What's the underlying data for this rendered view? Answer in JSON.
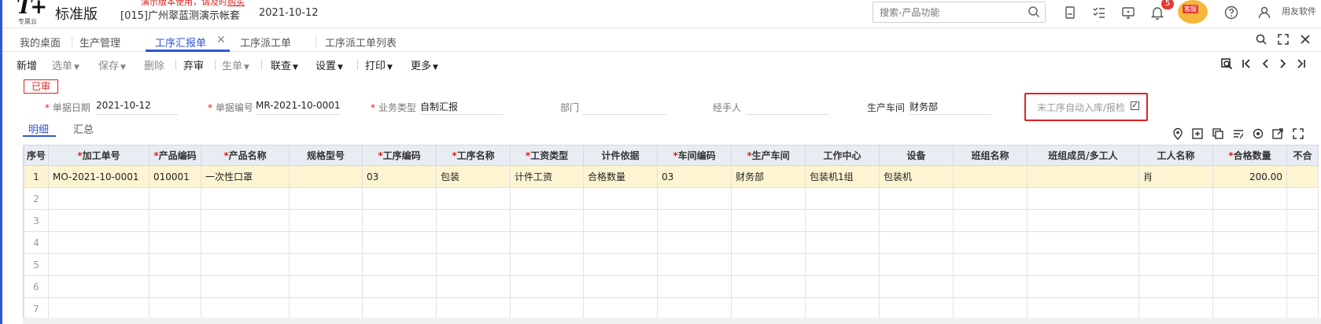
{
  "app": {
    "logo": "T+",
    "logo_sub": "专属云",
    "edition": "标准版",
    "demo_warning_prefix": "演示版本使用，请及时",
    "demo_warning_link": "购买",
    "account": "[015]广州翠蓝测演示帐套",
    "date": "2021-10-12",
    "search_placeholder": "搜索-产品功能",
    "notification_count": "5",
    "avatar_tag": "客服",
    "user": "用友软件"
  },
  "tabs": [
    {
      "label": "我的桌面"
    },
    {
      "label": "生产管理"
    },
    {
      "label": "工序汇报单"
    },
    {
      "label": "工序派工单"
    },
    {
      "label": "工序派工单列表"
    }
  ],
  "toolbar": {
    "items": [
      "新增",
      "选单",
      "保存",
      "删除",
      "弃审",
      "生单",
      "联查",
      "设置",
      "打印",
      "更多"
    ]
  },
  "status_tag": "已审",
  "form": {
    "date_label": "单据日期",
    "date_value": "2021-10-12",
    "code_label": "单据编号",
    "code_value": "MR-2021-10-0001",
    "biz_label": "业务类型",
    "biz_value": "自制汇报",
    "dept_label": "部门",
    "dept_value": "",
    "handler_label": "经手人",
    "handler_value": "",
    "workshop_label": "生产车间",
    "workshop_value": "财务部",
    "auto_label": "末工序自动入库/报检",
    "auto_checked": "✓"
  },
  "subtabs": [
    "明细",
    "汇总"
  ],
  "table": {
    "headers": [
      {
        "label": "序号",
        "req": ""
      },
      {
        "label": "加工单号",
        "req": "*"
      },
      {
        "label": "产品编码",
        "req": "*"
      },
      {
        "label": "产品名称",
        "req": "*"
      },
      {
        "label": "规格型号",
        "req": ""
      },
      {
        "label": "工序编码",
        "req": "*"
      },
      {
        "label": "工序名称",
        "req": "*"
      },
      {
        "label": "工资类型",
        "req": "*"
      },
      {
        "label": "计件依据",
        "req": ""
      },
      {
        "label": "车间编码",
        "req": "*"
      },
      {
        "label": "生产车间",
        "req": "*"
      },
      {
        "label": "工作中心",
        "req": ""
      },
      {
        "label": "设备",
        "req": ""
      },
      {
        "label": "班组名称",
        "req": ""
      },
      {
        "label": "班组成员/多工人",
        "req": ""
      },
      {
        "label": "工人名称",
        "req": ""
      },
      {
        "label": "合格数量",
        "req": "*"
      },
      {
        "label": "不合",
        "req": ""
      }
    ],
    "rows": [
      [
        "1",
        "MO-2021-10-0001",
        "010001",
        "一次性口罩",
        "",
        "03",
        "包装",
        "计件工资",
        "合格数量",
        "03",
        "财务部",
        "包装机1组",
        "包装机",
        "",
        "",
        "肖",
        "200.00",
        ""
      ],
      [
        "2",
        "",
        "",
        "",
        "",
        "",
        "",
        "",
        "",
        "",
        "",
        "",
        "",
        "",
        "",
        "",
        "",
        ""
      ],
      [
        "3",
        "",
        "",
        "",
        "",
        "",
        "",
        "",
        "",
        "",
        "",
        "",
        "",
        "",
        "",
        "",
        "",
        ""
      ],
      [
        "4",
        "",
        "",
        "",
        "",
        "",
        "",
        "",
        "",
        "",
        "",
        "",
        "",
        "",
        "",
        "",
        "",
        ""
      ],
      [
        "5",
        "",
        "",
        "",
        "",
        "",
        "",
        "",
        "",
        "",
        "",
        "",
        "",
        "",
        "",
        "",
        "",
        ""
      ],
      [
        "6",
        "",
        "",
        "",
        "",
        "",
        "",
        "",
        "",
        "",
        "",
        "",
        "",
        "",
        "",
        "",
        "",
        ""
      ],
      [
        "7",
        "",
        "",
        "",
        "",
        "",
        "",
        "",
        "",
        "",
        "",
        "",
        "",
        "",
        "",
        "",
        "",
        ""
      ]
    ]
  }
}
